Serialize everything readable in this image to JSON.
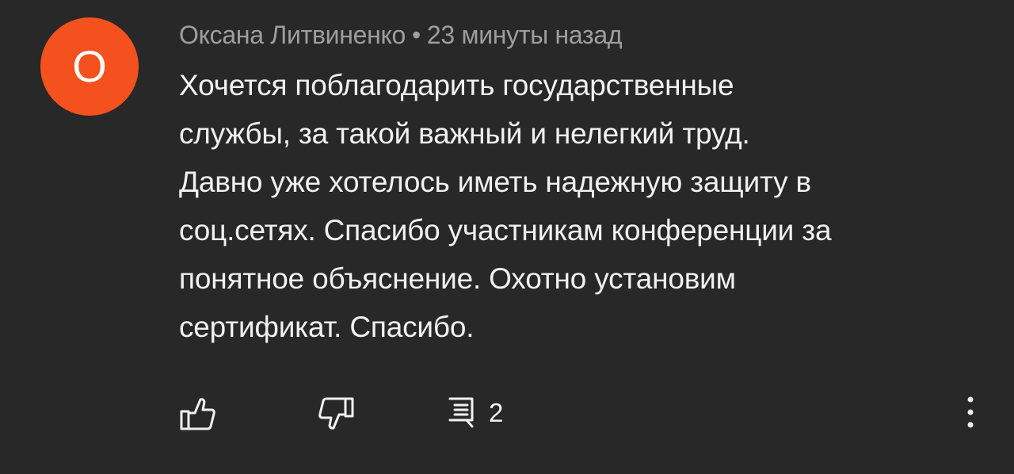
{
  "comment": {
    "avatar_letter": "О",
    "avatar_color": "#f4511e",
    "author": "Оксана Литвиненко",
    "separator": "•",
    "timestamp": "23 минуты назад",
    "text_lines": [
      "Хочется поблагодарить государственные",
      "службы, за такой важный и нелегкий труд.",
      "Давно уже хотелось иметь надежную защиту в",
      "соц.сетях. Спасибо участникам конференции за",
      "понятное объяснение. Охотно установим",
      "сертификат. Спасибо."
    ]
  },
  "actions": {
    "like_icon": "thumbs-up-icon",
    "dislike_icon": "thumbs-down-icon",
    "replies_icon": "comment-icon",
    "reply_count": "2",
    "more_icon": "more-vertical-icon"
  }
}
